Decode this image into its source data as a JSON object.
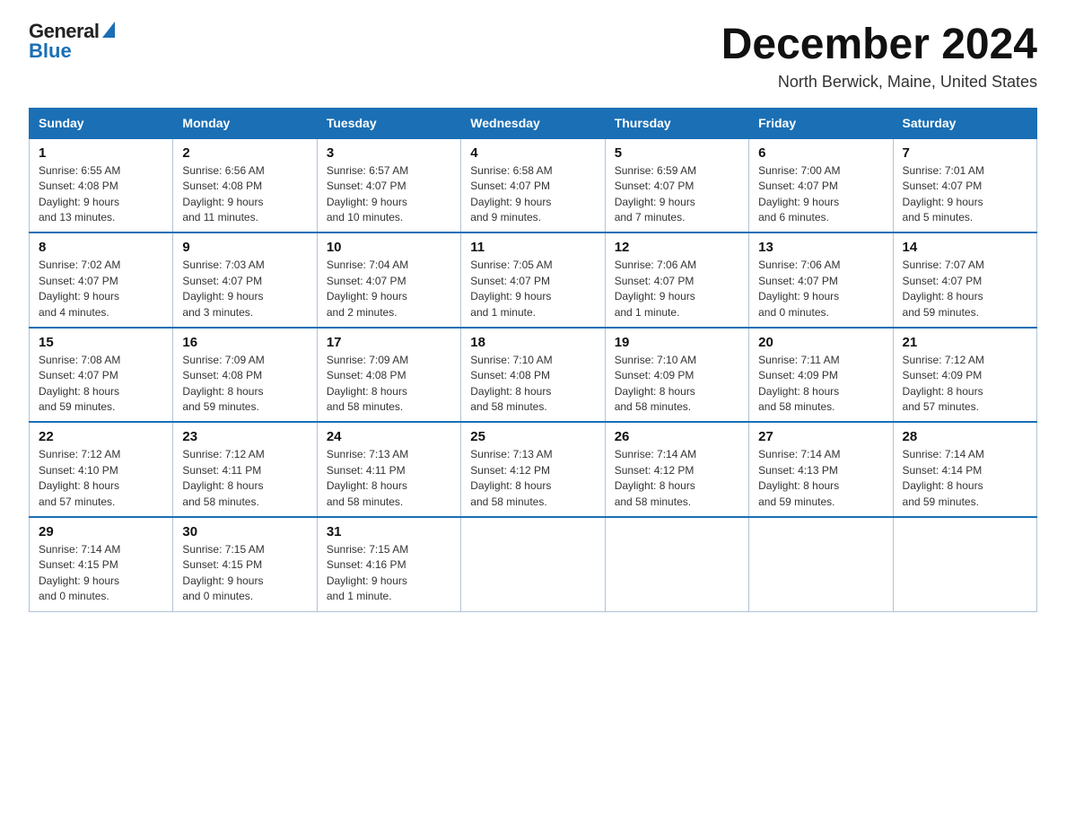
{
  "header": {
    "logo_general": "General",
    "logo_blue": "Blue",
    "month_title": "December 2024",
    "location": "North Berwick, Maine, United States"
  },
  "days_of_week": [
    "Sunday",
    "Monday",
    "Tuesday",
    "Wednesday",
    "Thursday",
    "Friday",
    "Saturday"
  ],
  "weeks": [
    [
      {
        "day": "1",
        "sunrise": "6:55 AM",
        "sunset": "4:08 PM",
        "daylight": "9 hours and 13 minutes."
      },
      {
        "day": "2",
        "sunrise": "6:56 AM",
        "sunset": "4:08 PM",
        "daylight": "9 hours and 11 minutes."
      },
      {
        "day": "3",
        "sunrise": "6:57 AM",
        "sunset": "4:07 PM",
        "daylight": "9 hours and 10 minutes."
      },
      {
        "day": "4",
        "sunrise": "6:58 AM",
        "sunset": "4:07 PM",
        "daylight": "9 hours and 9 minutes."
      },
      {
        "day": "5",
        "sunrise": "6:59 AM",
        "sunset": "4:07 PM",
        "daylight": "9 hours and 7 minutes."
      },
      {
        "day": "6",
        "sunrise": "7:00 AM",
        "sunset": "4:07 PM",
        "daylight": "9 hours and 6 minutes."
      },
      {
        "day": "7",
        "sunrise": "7:01 AM",
        "sunset": "4:07 PM",
        "daylight": "9 hours and 5 minutes."
      }
    ],
    [
      {
        "day": "8",
        "sunrise": "7:02 AM",
        "sunset": "4:07 PM",
        "daylight": "9 hours and 4 minutes."
      },
      {
        "day": "9",
        "sunrise": "7:03 AM",
        "sunset": "4:07 PM",
        "daylight": "9 hours and 3 minutes."
      },
      {
        "day": "10",
        "sunrise": "7:04 AM",
        "sunset": "4:07 PM",
        "daylight": "9 hours and 2 minutes."
      },
      {
        "day": "11",
        "sunrise": "7:05 AM",
        "sunset": "4:07 PM",
        "daylight": "9 hours and 1 minute."
      },
      {
        "day": "12",
        "sunrise": "7:06 AM",
        "sunset": "4:07 PM",
        "daylight": "9 hours and 1 minute."
      },
      {
        "day": "13",
        "sunrise": "7:06 AM",
        "sunset": "4:07 PM",
        "daylight": "9 hours and 0 minutes."
      },
      {
        "day": "14",
        "sunrise": "7:07 AM",
        "sunset": "4:07 PM",
        "daylight": "8 hours and 59 minutes."
      }
    ],
    [
      {
        "day": "15",
        "sunrise": "7:08 AM",
        "sunset": "4:07 PM",
        "daylight": "8 hours and 59 minutes."
      },
      {
        "day": "16",
        "sunrise": "7:09 AM",
        "sunset": "4:08 PM",
        "daylight": "8 hours and 59 minutes."
      },
      {
        "day": "17",
        "sunrise": "7:09 AM",
        "sunset": "4:08 PM",
        "daylight": "8 hours and 58 minutes."
      },
      {
        "day": "18",
        "sunrise": "7:10 AM",
        "sunset": "4:08 PM",
        "daylight": "8 hours and 58 minutes."
      },
      {
        "day": "19",
        "sunrise": "7:10 AM",
        "sunset": "4:09 PM",
        "daylight": "8 hours and 58 minutes."
      },
      {
        "day": "20",
        "sunrise": "7:11 AM",
        "sunset": "4:09 PM",
        "daylight": "8 hours and 58 minutes."
      },
      {
        "day": "21",
        "sunrise": "7:12 AM",
        "sunset": "4:09 PM",
        "daylight": "8 hours and 57 minutes."
      }
    ],
    [
      {
        "day": "22",
        "sunrise": "7:12 AM",
        "sunset": "4:10 PM",
        "daylight": "8 hours and 57 minutes."
      },
      {
        "day": "23",
        "sunrise": "7:12 AM",
        "sunset": "4:11 PM",
        "daylight": "8 hours and 58 minutes."
      },
      {
        "day": "24",
        "sunrise": "7:13 AM",
        "sunset": "4:11 PM",
        "daylight": "8 hours and 58 minutes."
      },
      {
        "day": "25",
        "sunrise": "7:13 AM",
        "sunset": "4:12 PM",
        "daylight": "8 hours and 58 minutes."
      },
      {
        "day": "26",
        "sunrise": "7:14 AM",
        "sunset": "4:12 PM",
        "daylight": "8 hours and 58 minutes."
      },
      {
        "day": "27",
        "sunrise": "7:14 AM",
        "sunset": "4:13 PM",
        "daylight": "8 hours and 59 minutes."
      },
      {
        "day": "28",
        "sunrise": "7:14 AM",
        "sunset": "4:14 PM",
        "daylight": "8 hours and 59 minutes."
      }
    ],
    [
      {
        "day": "29",
        "sunrise": "7:14 AM",
        "sunset": "4:15 PM",
        "daylight": "9 hours and 0 minutes."
      },
      {
        "day": "30",
        "sunrise": "7:15 AM",
        "sunset": "4:15 PM",
        "daylight": "9 hours and 0 minutes."
      },
      {
        "day": "31",
        "sunrise": "7:15 AM",
        "sunset": "4:16 PM",
        "daylight": "9 hours and 1 minute."
      },
      null,
      null,
      null,
      null
    ]
  ],
  "labels": {
    "sunrise": "Sunrise:",
    "sunset": "Sunset:",
    "daylight": "Daylight:"
  }
}
